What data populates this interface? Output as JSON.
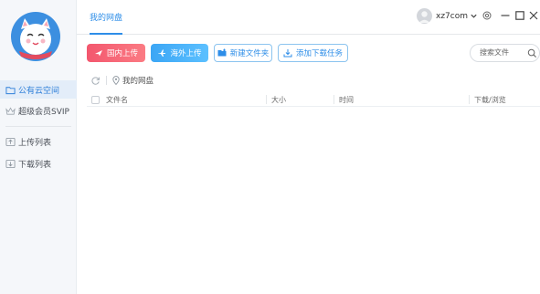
{
  "header": {
    "tab_title": "我的网盘",
    "username": "xz7com"
  },
  "sidebar": {
    "items": [
      {
        "label": "公有云空间"
      },
      {
        "label": "超级会员SVIP"
      },
      {
        "label": "上传列表"
      },
      {
        "label": "下载列表"
      }
    ]
  },
  "toolbar": {
    "upload_domestic": "国内上传",
    "upload_overseas": "海外上传",
    "new_folder": "新建文件夹",
    "add_download": "添加下载任务"
  },
  "search": {
    "placeholder": "搜索文件"
  },
  "breadcrumb": {
    "current": "我的网盘"
  },
  "table": {
    "columns": [
      "文件名",
      "大小",
      "时间",
      "下载/浏览"
    ]
  },
  "colors": {
    "accent": "#2e8ee8",
    "upload_domestic": "#f3576e",
    "upload_overseas": "#3ba6f5"
  },
  "icons": [
    "app-logo",
    "cloud-folder-icon",
    "crown-icon",
    "upload-list-icon",
    "download-list-icon",
    "chevron-down-icon",
    "settings-icon",
    "minimize-icon",
    "maximize-icon",
    "close-icon",
    "paper-plane-icon",
    "airplane-icon",
    "new-folder-icon",
    "download-icon",
    "search-icon",
    "refresh-icon",
    "location-pin-icon"
  ]
}
